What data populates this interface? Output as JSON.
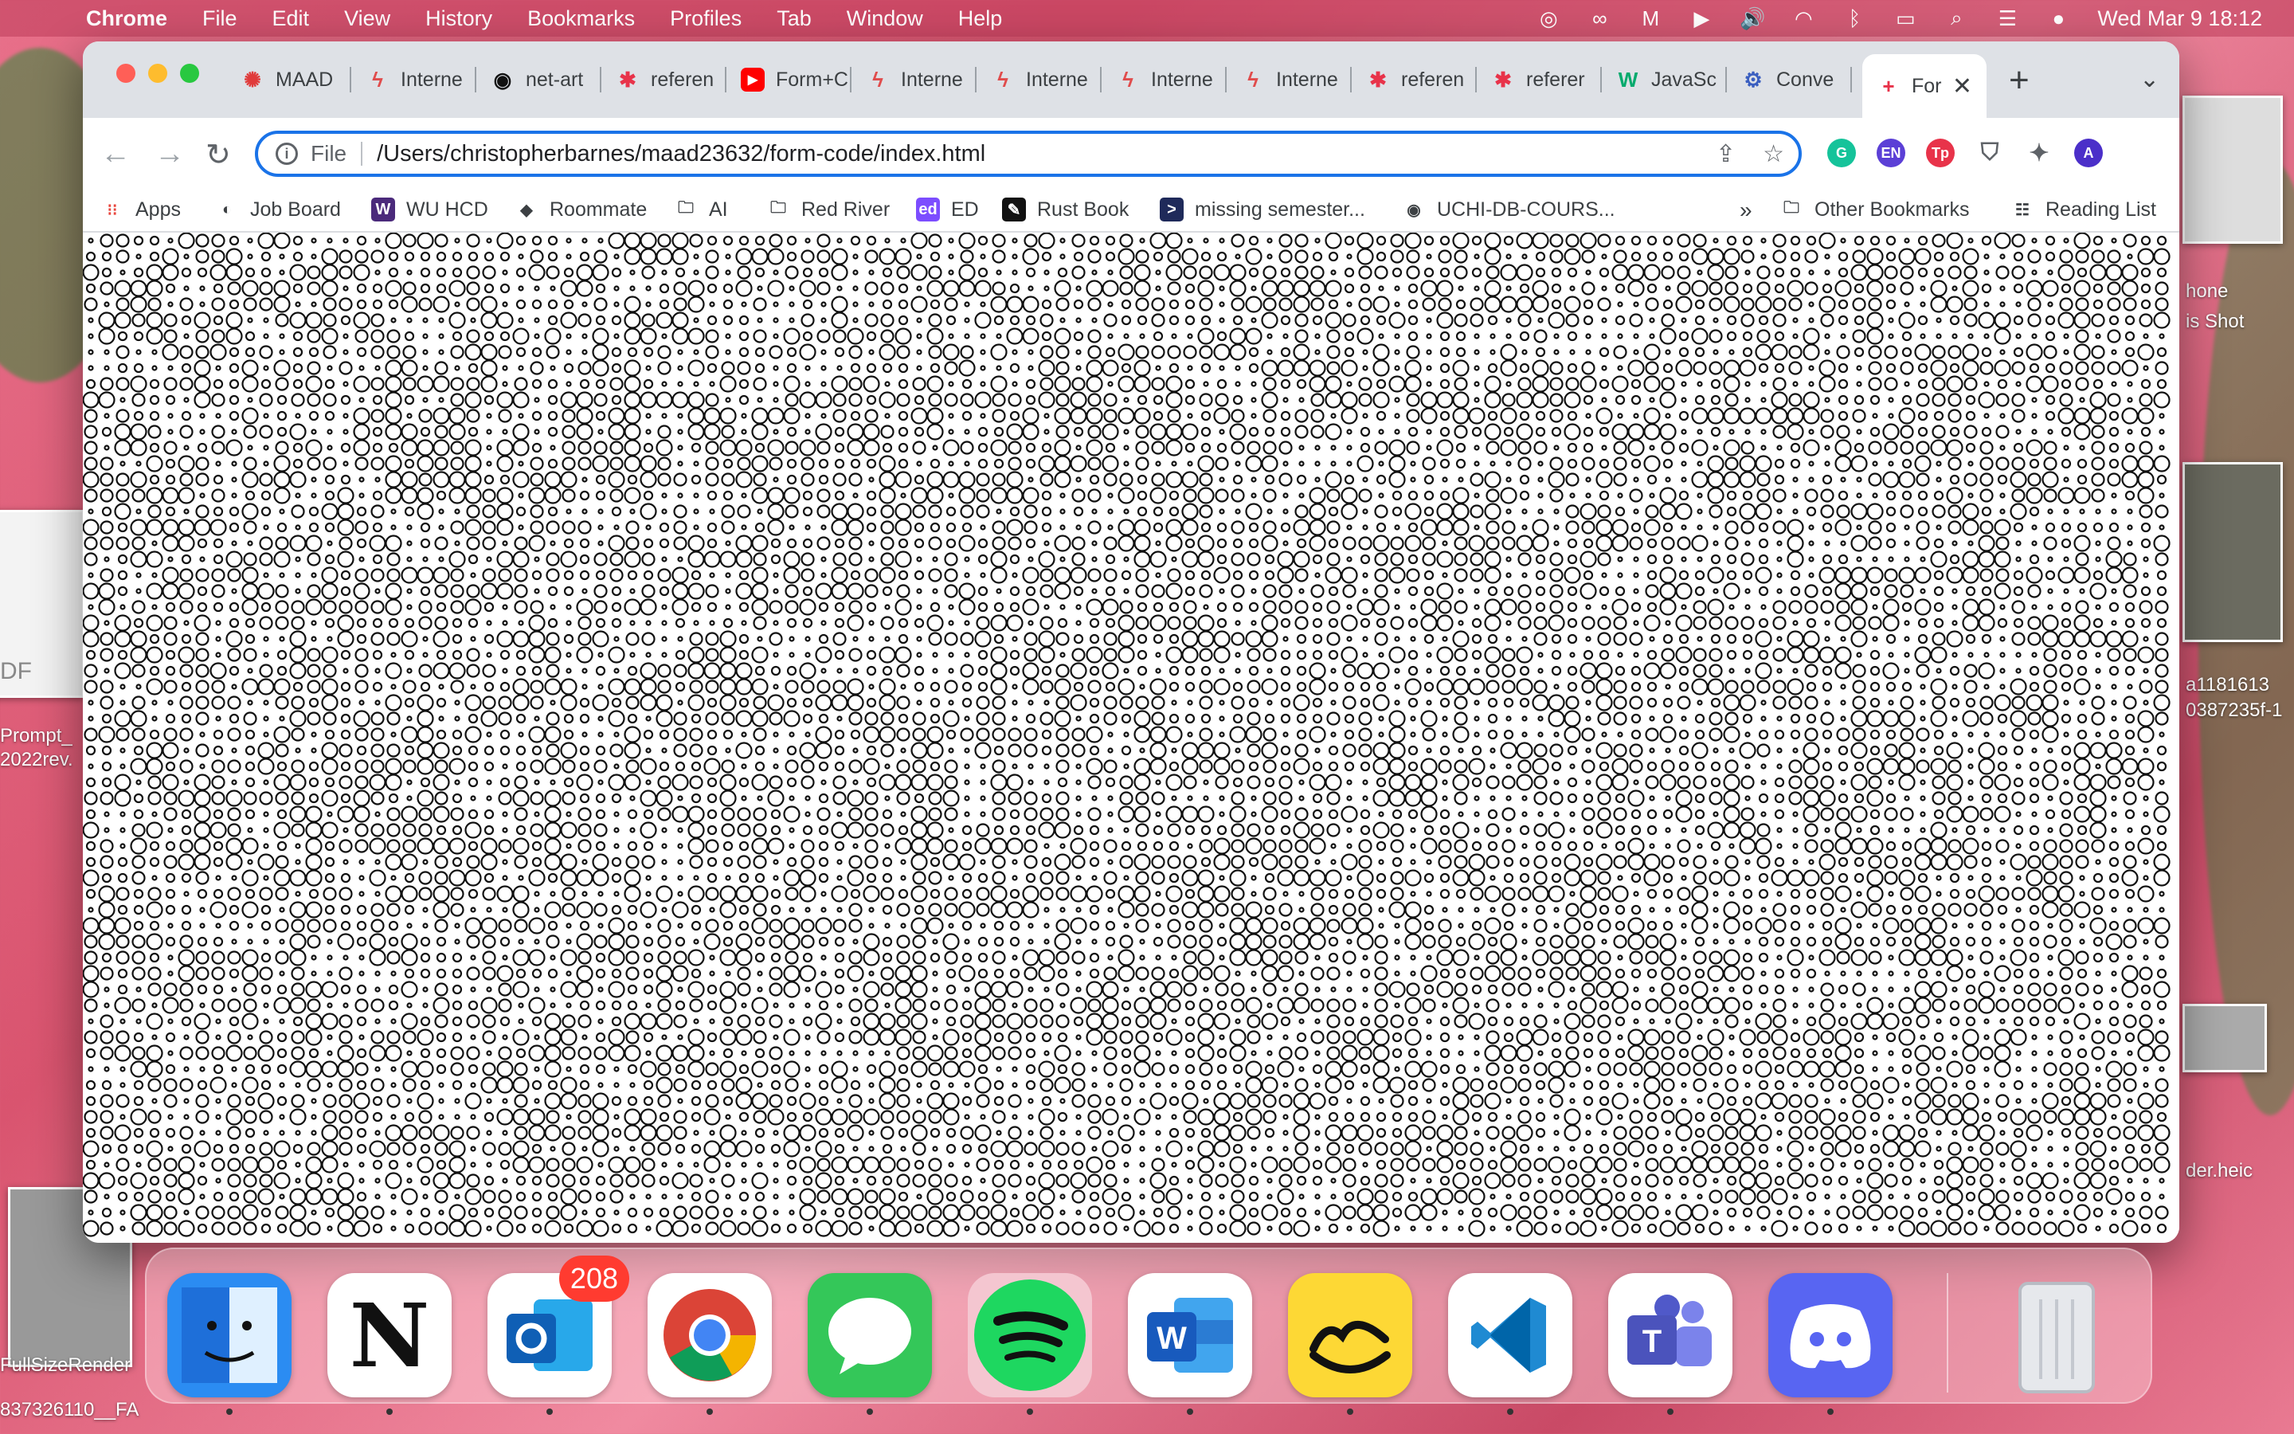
{
  "menubar": {
    "app_name": "Chrome",
    "items": [
      "File",
      "Edit",
      "View",
      "History",
      "Bookmarks",
      "Profiles",
      "Tab",
      "Window",
      "Help"
    ],
    "clock": "Wed Mar 9  18:12"
  },
  "desktop": {
    "files": [
      "DF",
      "Prompt_",
      "2022rev.",
      "hone",
      "is Shot",
      "a1181613",
      "0387235f-1",
      "der.heic",
      "FullSizeRender",
      "837326110__FA"
    ]
  },
  "browser": {
    "tabs": [
      {
        "label": "MAAD",
        "icon": "maad-icon",
        "color": "#e03b3b"
      },
      {
        "label": "Interne",
        "icon": "lightning-icon",
        "color": "#e04c4c"
      },
      {
        "label": "net-art",
        "icon": "github-icon",
        "color": "#111111"
      },
      {
        "label": "referen",
        "icon": "asterisk-icon",
        "color": "#e8334a"
      },
      {
        "label": "Form+C",
        "icon": "youtube-icon",
        "color": "#ff0000"
      },
      {
        "label": "Interne",
        "icon": "lightning-icon",
        "color": "#e04c4c"
      },
      {
        "label": "Interne",
        "icon": "lightning-icon",
        "color": "#e04c4c"
      },
      {
        "label": "Interne",
        "icon": "lightning-icon",
        "color": "#e04c4c"
      },
      {
        "label": "Interne",
        "icon": "lightning-icon",
        "color": "#e04c4c"
      },
      {
        "label": "referen",
        "icon": "asterisk-icon",
        "color": "#e8334a"
      },
      {
        "label": "referer",
        "icon": "asterisk-icon",
        "color": "#e8334a"
      },
      {
        "label": "JavaSc",
        "icon": "w3-icon",
        "color": "#04aa6d"
      },
      {
        "label": "Conve",
        "icon": "gear-icon",
        "color": "#3b5fc0"
      }
    ],
    "active_tab": {
      "label": "For",
      "icon": "plus-icon",
      "color": "#e8334a"
    },
    "address": {
      "scheme": "File",
      "url": "/Users/christopherbarnes/maad23632/form-code/index.html"
    },
    "extensions": [
      {
        "name": "grammarly-icon",
        "glyph": "G",
        "color": "#15c39a"
      },
      {
        "name": "language-icon",
        "glyph": "EN",
        "color": "#5b3fd6"
      },
      {
        "name": "tp-icon",
        "glyph": "Tp",
        "color": "#e8334a"
      },
      {
        "name": "shield-icon",
        "glyph": "⛉",
        "color": "#5f6368"
      },
      {
        "name": "puzzle-icon",
        "glyph": "✦",
        "color": "#5f6368"
      },
      {
        "name": "profile-avatar",
        "glyph": "A",
        "color": "#4b2fc9"
      }
    ],
    "bookmarks": [
      {
        "label": "Apps",
        "icon": "apps-grid-icon"
      },
      {
        "label": "Job Board",
        "icon": "globe-icon"
      },
      {
        "label": "WU HCD",
        "icon": "wu-icon"
      },
      {
        "label": "Roommate",
        "icon": "cube-icon"
      },
      {
        "label": "AI",
        "icon": "folder-icon"
      },
      {
        "label": "Red River",
        "icon": "folder-icon"
      },
      {
        "label": "ED",
        "icon": "ed-icon"
      },
      {
        "label": "Rust Book",
        "icon": "rust-icon"
      },
      {
        "label": "missing semester...",
        "icon": "terminal-icon"
      },
      {
        "label": "UCHI-DB-COURS...",
        "icon": "github-icon"
      }
    ],
    "bookmarks_overflow": "»",
    "other_bookmarks": "Other Bookmarks",
    "reading_list": "Reading List"
  },
  "dock": {
    "apps": [
      {
        "name": "finder",
        "color": "#2b8cf2"
      },
      {
        "name": "notion",
        "color": "#ffffff"
      },
      {
        "name": "outlook",
        "color": "#ffffff",
        "badge": "208"
      },
      {
        "name": "chrome",
        "color": "#ffffff"
      },
      {
        "name": "messages",
        "color": "#34c759"
      },
      {
        "name": "spotify",
        "color": "#1ed760"
      },
      {
        "name": "word",
        "color": "#ffffff"
      },
      {
        "name": "basecamp",
        "color": "#fdd835"
      },
      {
        "name": "vscode",
        "color": "#ffffff"
      },
      {
        "name": "teams",
        "color": "#ffffff"
      },
      {
        "name": "discord",
        "color": "#5865f2"
      }
    ]
  }
}
